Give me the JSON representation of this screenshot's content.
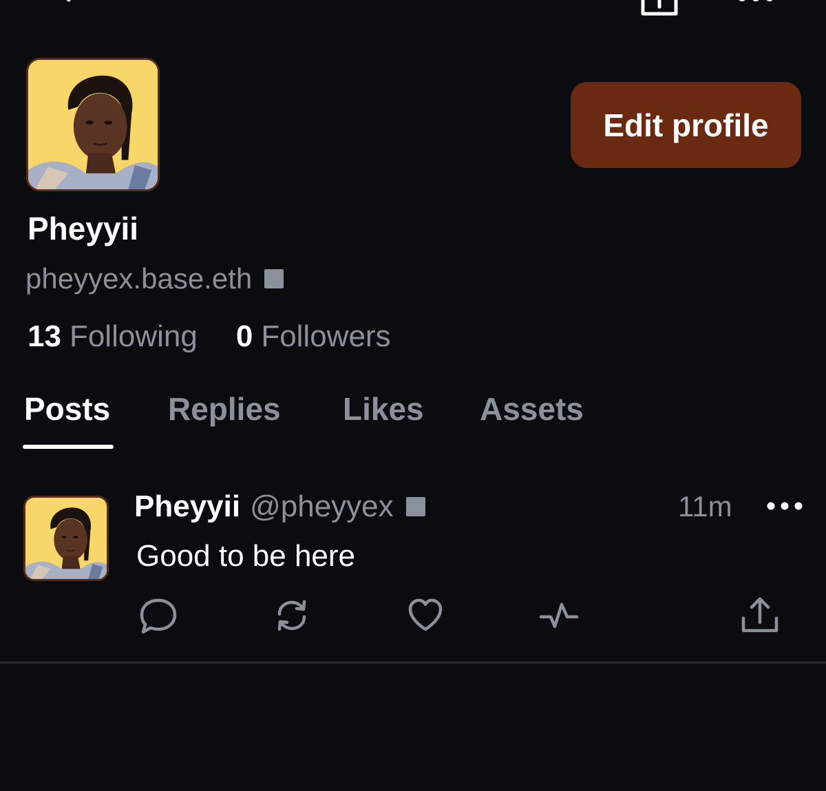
{
  "top_bar": {
    "back_icon": "arrow-left-icon",
    "share_icon": "share-upload-icon",
    "more_icon": "more-horizontal-icon"
  },
  "profile": {
    "display_name": "Pheyyii",
    "handle": "pheyyex.base.eth",
    "edit_button_label": "Edit profile",
    "following_count": "13",
    "following_label": "Following",
    "followers_count": "0",
    "followers_label": "Followers"
  },
  "tabs": [
    {
      "label": "Posts",
      "active": true
    },
    {
      "label": "Replies",
      "active": false
    },
    {
      "label": "Likes",
      "active": false
    },
    {
      "label": "Assets",
      "active": false
    }
  ],
  "post": {
    "author": "Pheyyii",
    "handle": "@pheyyex",
    "time": "11m",
    "text": "Good to be here",
    "actions": [
      "reply-icon",
      "repost-icon",
      "like-icon",
      "activity-icon",
      "share-icon"
    ]
  },
  "colors": {
    "background": "#0a0c0f",
    "accent_button": "#6a2a12",
    "muted_text": "#8b919b",
    "avatar_bg": "#f7d66a"
  }
}
